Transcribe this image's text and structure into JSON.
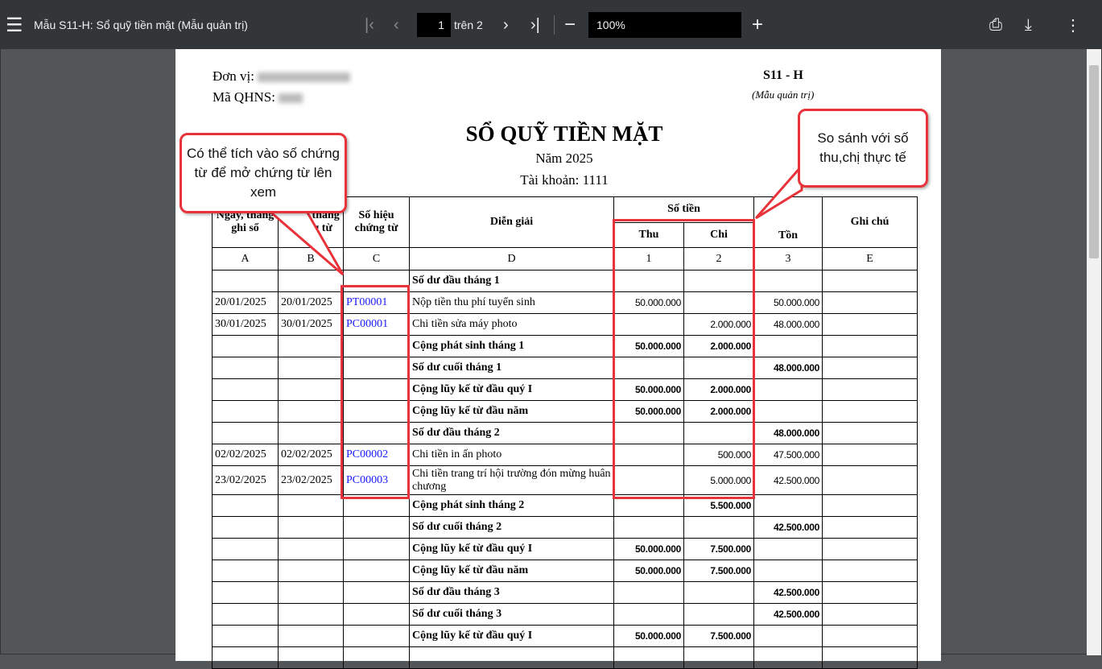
{
  "toolbar": {
    "title": "Mẫu S11-H: Sổ quỹ tiền mặt (Mẫu quản trị)",
    "page": "1",
    "page_of": "trên 2",
    "zoom": "100%"
  },
  "doc": {
    "don_vi_label": "Đơn vị:",
    "ma_qhns_label": "Mã QHNS:",
    "form_code": "S11 - H",
    "form_note": "(Mẫu quản trị)",
    "title": "SỔ QUỸ TIỀN MẶT",
    "year": "Năm 2025",
    "account": "Tài khoản: 1111"
  },
  "headers": {
    "a": "Ngày, tháng ghi sổ",
    "b": "Ngày, tháng chứng từ",
    "c": "Số hiệu chứng từ",
    "d": "Diễn giải",
    "so_tien": "Số tiền",
    "thu": "Thu",
    "chi": "Chi",
    "ton": "Tồn",
    "e": "Ghi chú",
    "letters": [
      "A",
      "B",
      "C",
      "D",
      "1",
      "2",
      "3",
      "E"
    ]
  },
  "rows": [
    {
      "a": "",
      "b": "",
      "c": "",
      "d": "Số dư đầu tháng 1",
      "thu": "",
      "chi": "",
      "ton": "",
      "bold": true
    },
    {
      "a": "20/01/2025",
      "b": "20/01/2025",
      "c": "PT00001",
      "d": "Nộp tiền thu phí tuyển sinh",
      "thu": "50.000.000",
      "chi": "",
      "ton": "50.000.000"
    },
    {
      "a": "30/01/2025",
      "b": "30/01/2025",
      "c": "PC00001",
      "d": "Chi tiền sửa máy photo",
      "thu": "",
      "chi": "2.000.000",
      "ton": "48.000.000"
    },
    {
      "a": "",
      "b": "",
      "c": "",
      "d": "Cộng phát sinh tháng 1",
      "thu": "50.000.000",
      "chi": "2.000.000",
      "ton": "",
      "bold": true
    },
    {
      "a": "",
      "b": "",
      "c": "",
      "d": "Số dư cuối tháng 1",
      "thu": "",
      "chi": "",
      "ton": "48.000.000",
      "bold": true
    },
    {
      "a": "",
      "b": "",
      "c": "",
      "d": "Cộng lũy kế từ đầu quý I",
      "thu": "50.000.000",
      "chi": "2.000.000",
      "ton": "",
      "bold": true
    },
    {
      "a": "",
      "b": "",
      "c": "",
      "d": "Cộng lũy kế từ đầu năm",
      "thu": "50.000.000",
      "chi": "2.000.000",
      "ton": "",
      "bold": true
    },
    {
      "a": "",
      "b": "",
      "c": "",
      "d": "Số dư đầu tháng 2",
      "thu": "",
      "chi": "",
      "ton": "48.000.000",
      "bold": true
    },
    {
      "a": "02/02/2025",
      "b": "02/02/2025",
      "c": "PC00002",
      "d": "Chi tiền in ấn photo",
      "thu": "",
      "chi": "500.000",
      "ton": "47.500.000"
    },
    {
      "a": "23/02/2025",
      "b": "23/02/2025",
      "c": "PC00003",
      "d": "Chi tiền trang trí hội trường đón mừng huân chương",
      "thu": "",
      "chi": "5.000.000",
      "ton": "42.500.000"
    },
    {
      "a": "",
      "b": "",
      "c": "",
      "d": "Cộng phát sinh tháng 2",
      "thu": "",
      "chi": "5.500.000",
      "ton": "",
      "bold": true
    },
    {
      "a": "",
      "b": "",
      "c": "",
      "d": "Số dư cuối tháng 2",
      "thu": "",
      "chi": "",
      "ton": "42.500.000",
      "bold": true
    },
    {
      "a": "",
      "b": "",
      "c": "",
      "d": "Cộng lũy kế từ đầu quý I",
      "thu": "50.000.000",
      "chi": "7.500.000",
      "ton": "",
      "bold": true
    },
    {
      "a": "",
      "b": "",
      "c": "",
      "d": "Cộng lũy kế từ đầu năm",
      "thu": "50.000.000",
      "chi": "7.500.000",
      "ton": "",
      "bold": true
    },
    {
      "a": "",
      "b": "",
      "c": "",
      "d": "Số dư đầu tháng 3",
      "thu": "",
      "chi": "",
      "ton": "42.500.000",
      "bold": true
    },
    {
      "a": "",
      "b": "",
      "c": "",
      "d": "Số dư cuối tháng 3",
      "thu": "",
      "chi": "",
      "ton": "42.500.000",
      "bold": true
    },
    {
      "a": "",
      "b": "",
      "c": "",
      "d": "Cộng lũy kế từ đầu quý I",
      "thu": "50.000.000",
      "chi": "7.500.000",
      "ton": "",
      "bold": true
    },
    {
      "a": "",
      "b": "",
      "c": "",
      "d": "",
      "thu": "",
      "chi": "",
      "ton": ""
    }
  ],
  "callouts": {
    "left": "Có thể tích vào số chứng từ để mở chứng từ lên xem",
    "right": "So sánh với số thu,chị thực tế"
  }
}
